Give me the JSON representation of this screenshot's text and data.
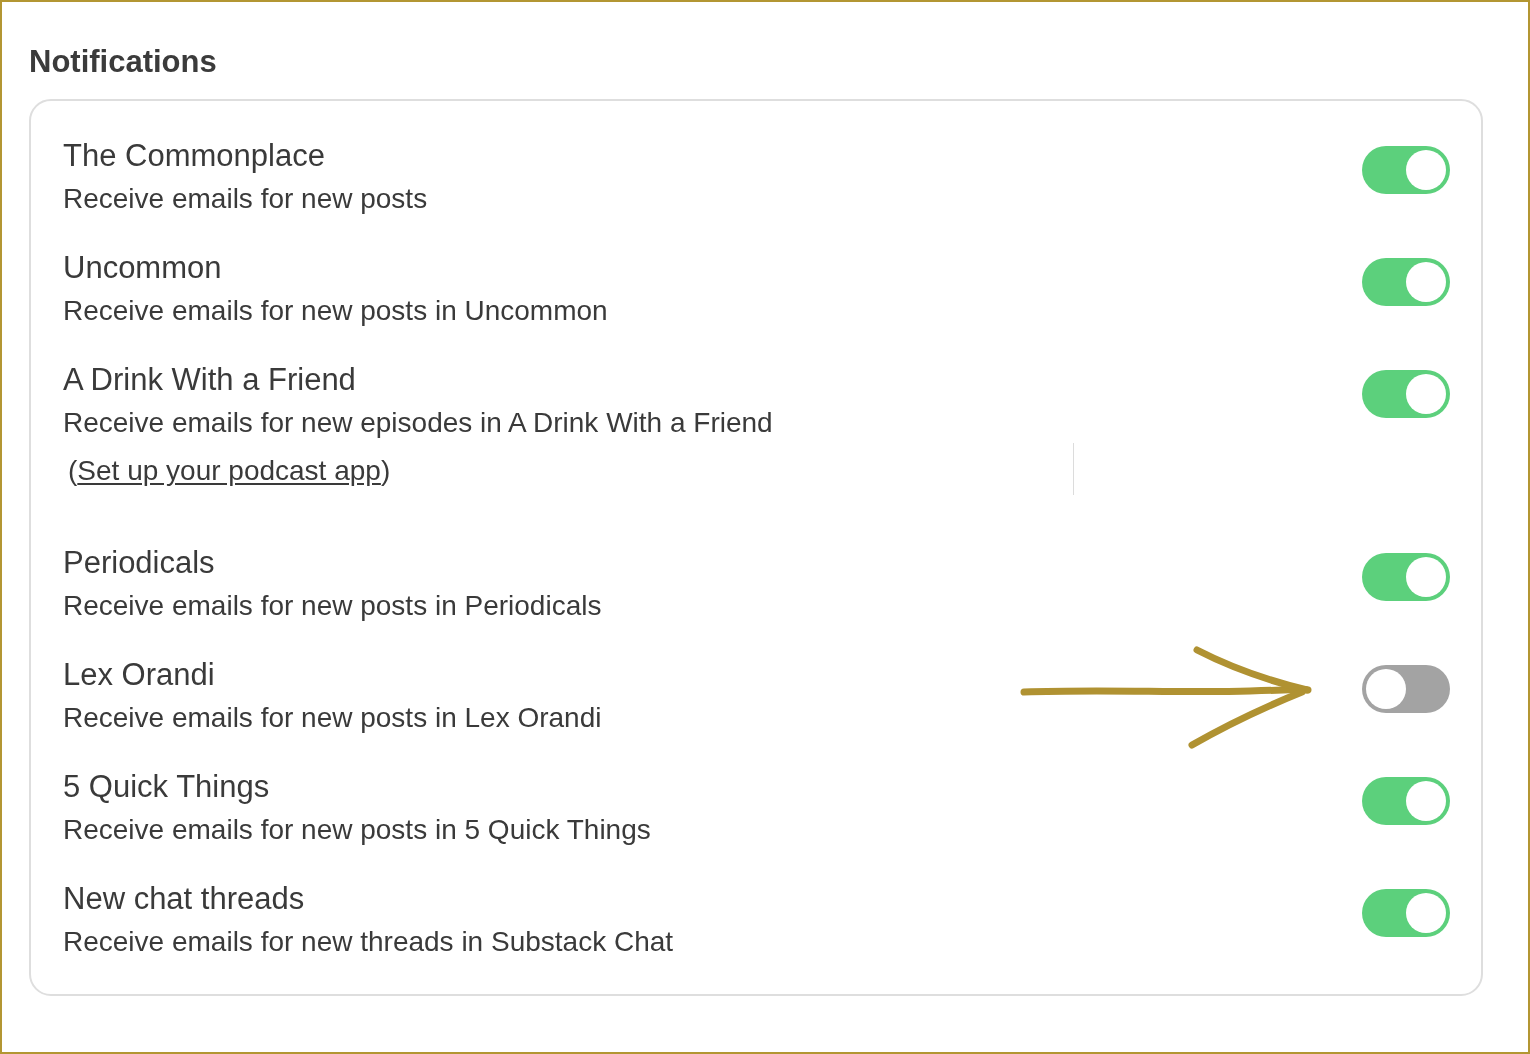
{
  "section": {
    "title": "Notifications"
  },
  "items": [
    {
      "title": "The Commonplace",
      "description": "Receive emails for new posts",
      "on": true,
      "annotated": false
    },
    {
      "title": "Uncommon",
      "description": "Receive emails for new posts in Uncommon",
      "on": true,
      "annotated": false
    },
    {
      "title": "A Drink With a Friend",
      "description": "Receive emails for new episodes in A Drink With a Friend",
      "on": true,
      "annotated": false,
      "note": {
        "prefix": "(",
        "link": "Set up your podcast app",
        "suffix": ")"
      }
    },
    {
      "title": "Periodicals",
      "description": "Receive emails for new posts in Periodicals",
      "on": true,
      "annotated": false
    },
    {
      "title": "Lex Orandi",
      "description": "Receive emails for new posts in Lex Orandi",
      "on": false,
      "annotated": true
    },
    {
      "title": "5 Quick Things",
      "description": "Receive emails for new posts in 5 Quick Things",
      "on": true,
      "annotated": false
    },
    {
      "title": "New chat threads",
      "description": "Receive emails for new threads in Substack Chat",
      "on": true,
      "annotated": false
    }
  ]
}
